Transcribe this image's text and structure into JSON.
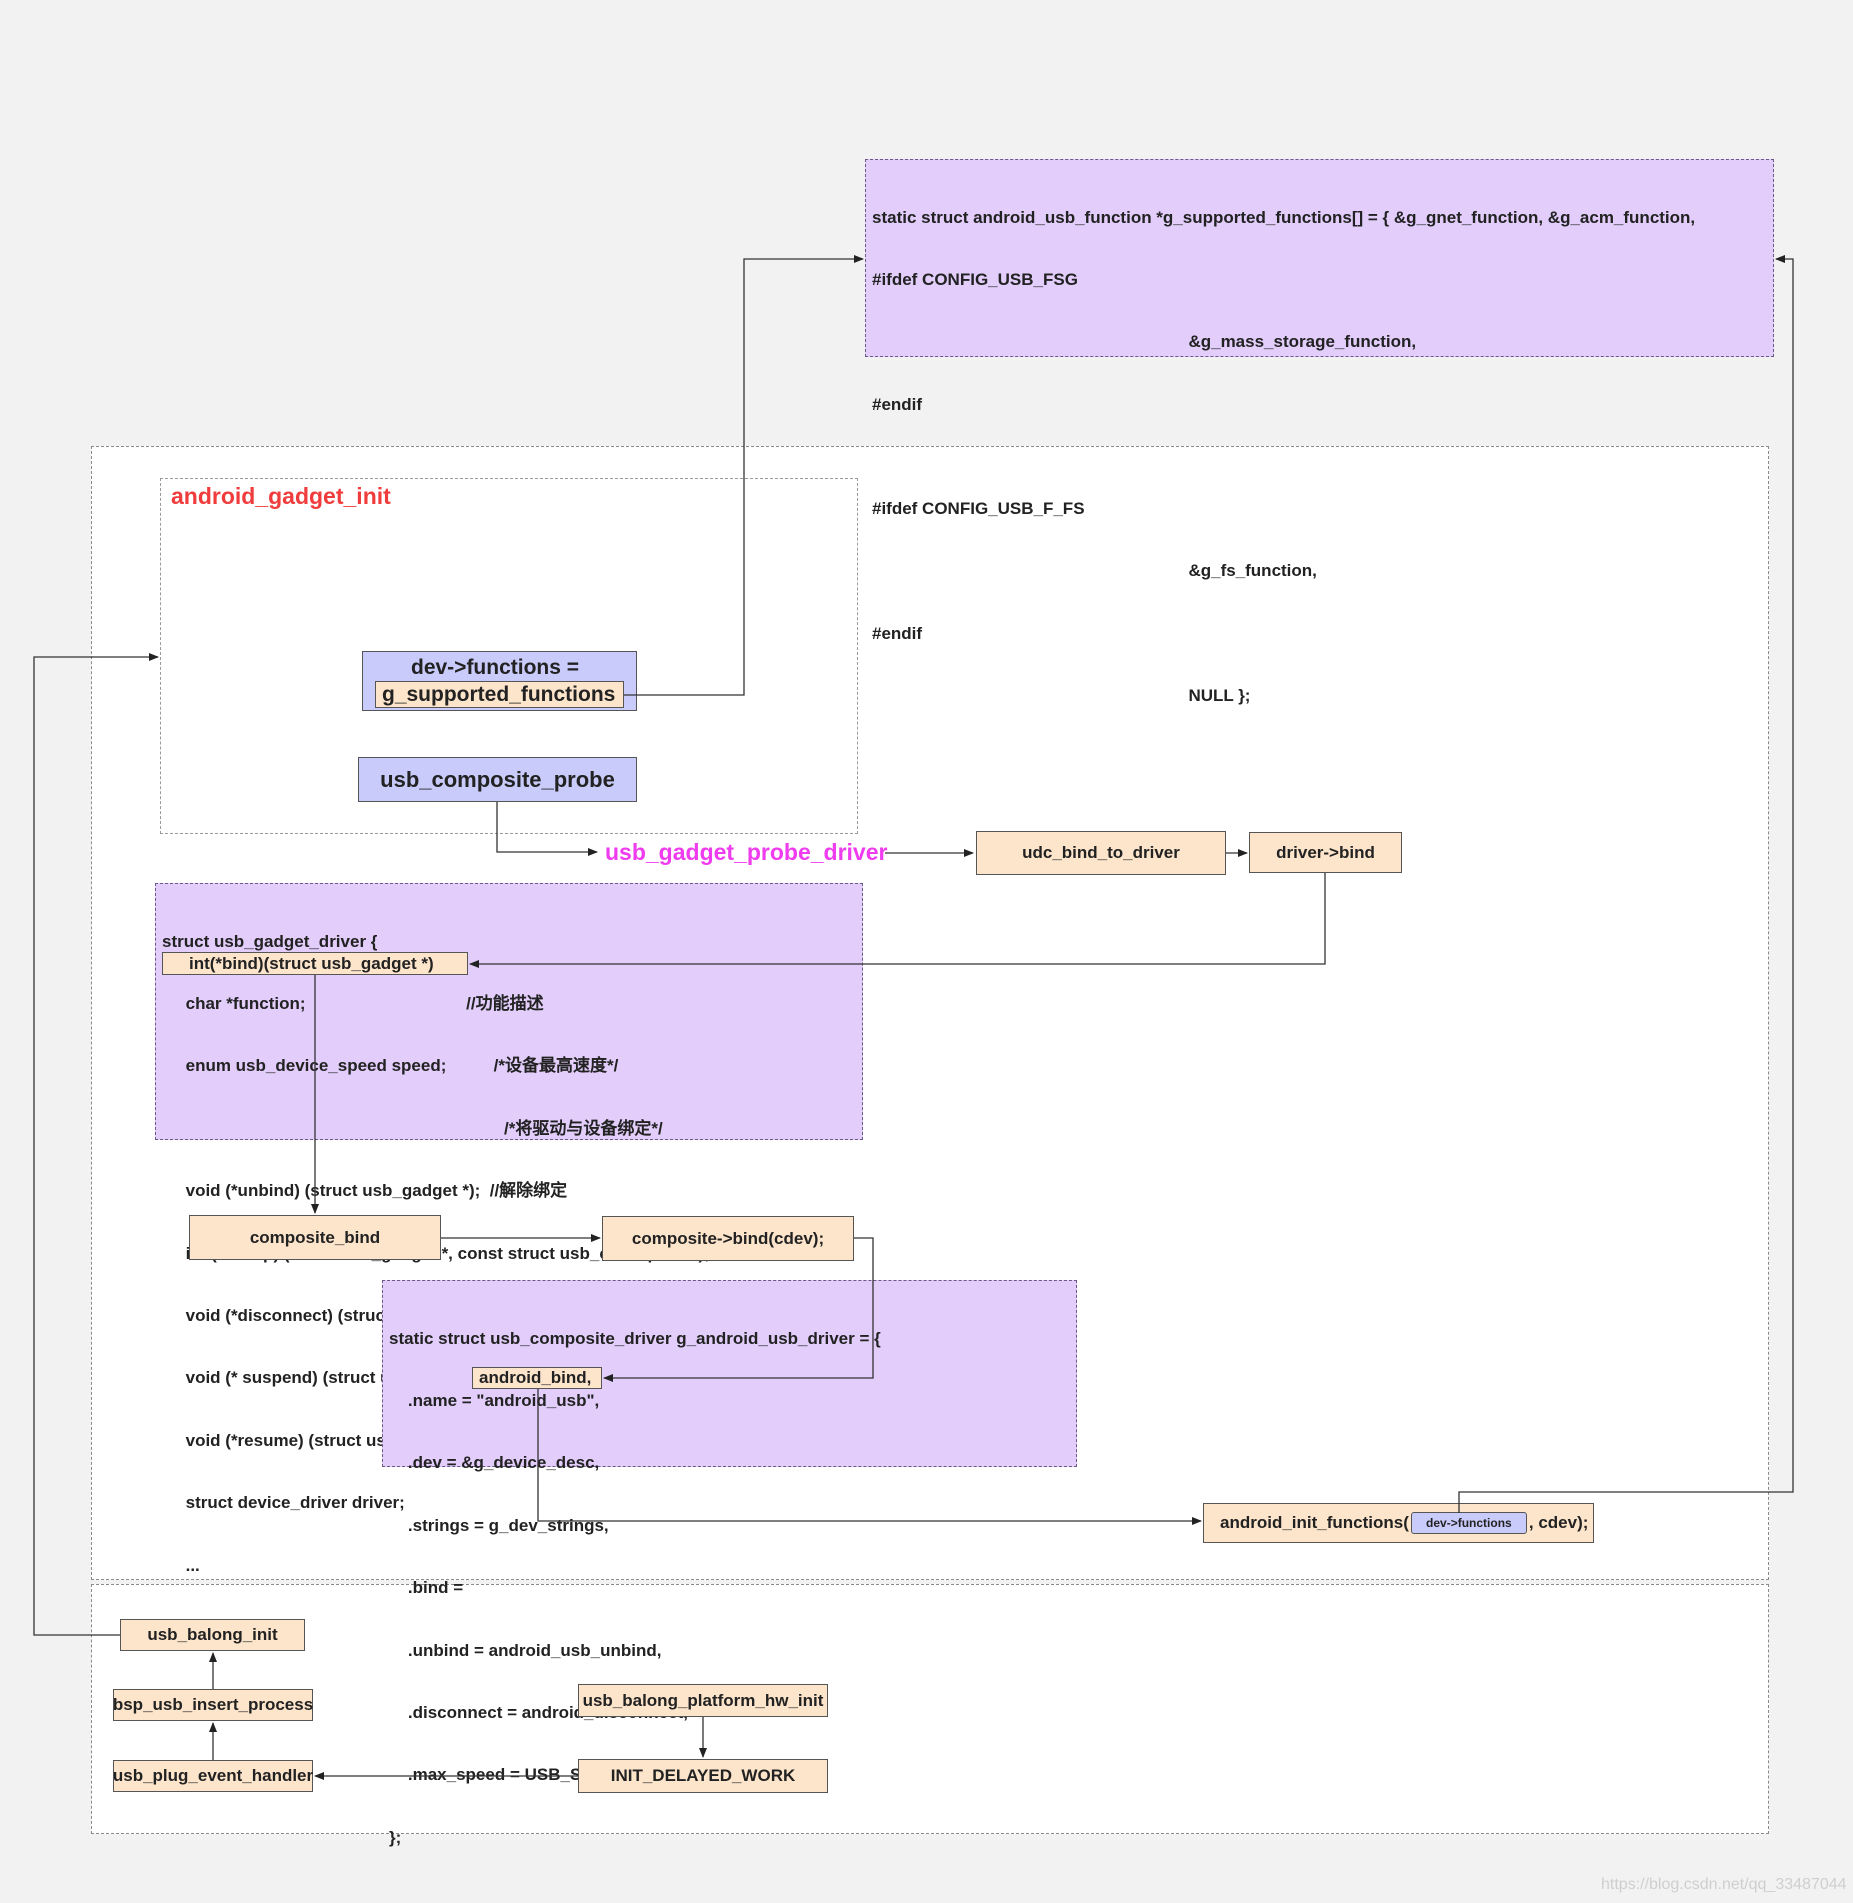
{
  "supported_functions_code": [
    "static struct android_usb_function *g_supported_functions[] = { &g_gnet_function, &g_acm_function,",
    "#ifdef CONFIG_USB_FSG",
    "                                                                   &g_mass_storage_function,",
    "#endif",
    "",
    "#ifdef CONFIG_USB_F_FS",
    "                                                                   &g_fs_function,",
    "#endif",
    "                                                                   NULL };"
  ],
  "android_gadget_init": {
    "title": "android_gadget_init",
    "dev_functions_line1": "dev->functions =",
    "dev_functions_line2": "g_supported_functions",
    "usb_composite_probe": "usb_composite_probe"
  },
  "usb_gadget_probe_driver": "usb_gadget_probe_driver",
  "udc_bind_to_driver": "udc_bind_to_driver",
  "driver_bind": "driver->bind",
  "gadget_driver_struct": {
    "line_open": "struct usb_gadget_driver {",
    "line_function": "     char *function;                                  //功能描述",
    "line_speed": "     enum usb_device_speed speed;          /*设备最高速度*/",
    "bind_highlight": "int(*bind)(struct usb_gadget *)",
    "bind_comment": "/*将驱动与设备绑定*/",
    "line_unbind": "     void (*unbind) (struct usb_gadget *);  //解除绑定",
    "line_setup": "     int (* setup) (struct usb_gadget *, const struct usb_ctrlrequest *);",
    "line_disconnect": "     void (*disconnect) (struct usb_gadget *); //设备断开是调用",
    "line_suspend": "     void (* suspend) (struct usb_gadget *);",
    "line_resume": "     void (*resume) (struct usb_gadget *);",
    "line_driver": "     struct device_driver driver;",
    "line_ellipsis": "     ...",
    "line_close": "};"
  },
  "composite_bind": "composite_bind",
  "composite_bind_cdev": "composite->bind(cdev);",
  "composite_driver_struct": {
    "line_open": "static struct usb_composite_driver g_android_usb_driver = {",
    "line_name": "    .name = \"android_usb\",",
    "line_dev": "    .dev = &g_device_desc,",
    "line_strings": "    .strings = g_dev_strings,",
    "bind_prefix": "    .bind = ",
    "bind_highlight": "android_bind,",
    "line_unbind": "    .unbind = android_usb_unbind,",
    "line_disconnect": "    .disconnect = android_disconnect,",
    "line_max_speed": "    .max_speed = USB_SPEED_SUPER,",
    "line_close": "};"
  },
  "android_init_functions": {
    "prefix": "android_init_functions(",
    "arg": "dev->functions",
    "suffix": ", cdev);"
  },
  "usb_balong_init": "usb_balong_init",
  "bsp_usb_insert_process": "bsp_usb_insert_process",
  "usb_plug_event_handler": "usb_plug_event_handler",
  "usb_balong_platform_hw_init": "usb_balong_platform_hw_init",
  "init_delayed_work": "INIT_DELAYED_WORK",
  "watermark": "https://blog.csdn.net/qq_33487044",
  "colors": {
    "background": "#f2f2f2",
    "code_box": "#e2cdfb",
    "node": "#fde5cc",
    "blue_node": "#c9cbfb",
    "title_red": "#f03c3c",
    "title_magenta": "#ee3cee"
  }
}
